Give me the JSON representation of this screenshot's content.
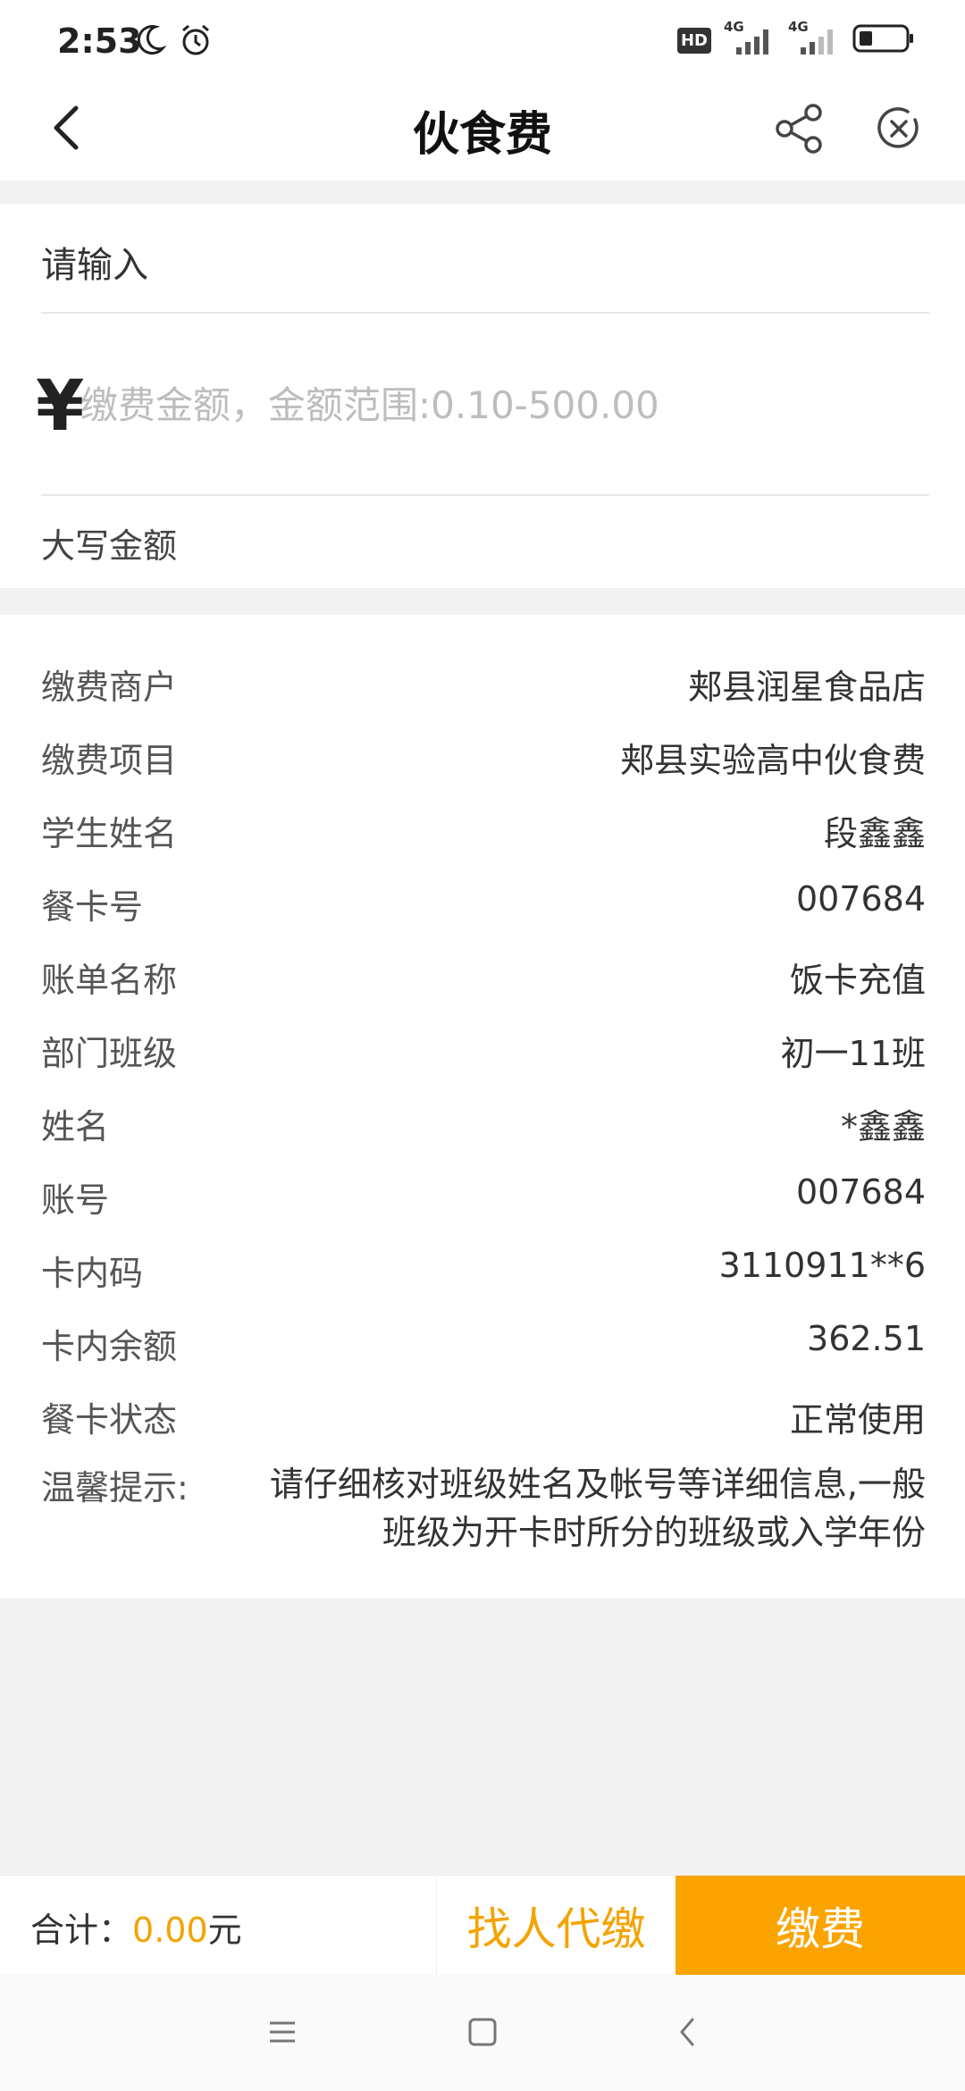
{
  "status_bar": {
    "time": "2:53",
    "network_badge": "HD",
    "sim1_label": "4G",
    "sim2_label": "4G",
    "icons": [
      "moon-icon",
      "alarm-icon",
      "hd-badge-icon",
      "signal-icon",
      "signal-icon",
      "battery-icon"
    ]
  },
  "header": {
    "title": "伙食费",
    "back_icon": "chevron-left-icon",
    "share_icon": "share-icon",
    "close_icon": "close-circle-icon"
  },
  "input_card": {
    "prompt": "请输入",
    "currency_symbol": "¥",
    "amount_value": "",
    "amount_placeholder": "缴费金额，金额范围:0.10-500.00",
    "capital_amount_label": "大写金额"
  },
  "info": {
    "rows": [
      {
        "label": "缴费商户",
        "value": "郏县润星食品店"
      },
      {
        "label": "缴费项目",
        "value": "郏县实验高中伙食费"
      },
      {
        "label": "学生姓名",
        "value": "段鑫鑫"
      },
      {
        "label": "餐卡号",
        "value": "007684"
      },
      {
        "label": "账单名称",
        "value": "饭卡充值"
      },
      {
        "label": "部门班级",
        "value": "初一11班"
      },
      {
        "label": "姓名",
        "value": "*鑫鑫"
      },
      {
        "label": "账号",
        "value": "007684"
      },
      {
        "label": "卡内码",
        "value": "3110911**6"
      },
      {
        "label": "卡内余额",
        "value": "362.51"
      },
      {
        "label": "餐卡状态",
        "value": "正常使用"
      }
    ],
    "tip_label": "温馨提示:",
    "tip_text": "请仔细核对班级姓名及帐号等详细信息,一般班级为开卡时所分的班级或入学年份"
  },
  "bottom_bar": {
    "total_label": "合计：",
    "total_amount": "0.00",
    "total_unit": "元",
    "proxy_pay_label": "找人代缴",
    "pay_label": "缴费",
    "accent_color": "#fba400"
  },
  "system_nav": {
    "icons": [
      "menu-icon",
      "home-square-icon",
      "back-triangle-icon"
    ]
  }
}
